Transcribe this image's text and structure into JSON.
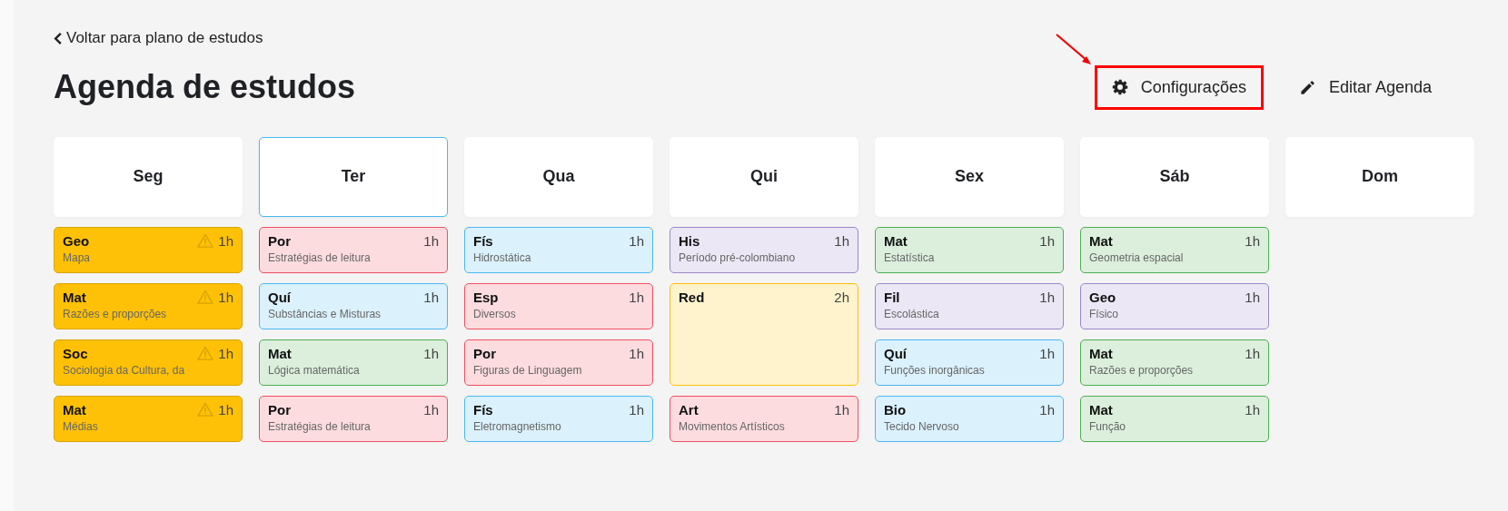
{
  "back_link": "Voltar para plano de estudos",
  "title": "Agenda de estudos",
  "actions": [
    {
      "kind": "settings",
      "label": "Configurações",
      "highlighted": true
    },
    {
      "kind": "edit",
      "label": "Editar Agenda",
      "highlighted": false
    }
  ],
  "days": [
    {
      "name": "Seg",
      "selected": false,
      "cards": [
        {
          "subject": "Geo",
          "topic": "Mapa",
          "hours": "1h",
          "warning": true,
          "kind": "single",
          "color": "#ffc107"
        },
        {
          "subject": "Mat",
          "topic": "Razões e proporções",
          "hours": "1h",
          "warning": true,
          "kind": "single",
          "color": "#ffc107"
        },
        {
          "subject": "Soc",
          "topic": "Sociologia da Cultura, da",
          "hours": "1h",
          "warning": true,
          "kind": "single",
          "color": "#ffc107"
        },
        {
          "subject": "Mat",
          "topic": "Médias",
          "hours": "1h",
          "warning": true,
          "kind": "single",
          "color": "#ffc107"
        }
      ]
    },
    {
      "name": "Ter",
      "selected": true,
      "cards": [
        {
          "subject": "Por",
          "topic": "Estratégias de leitura",
          "hours": "1h",
          "warning": false,
          "kind": "single",
          "color": "#f0505f"
        },
        {
          "subject": "Quí",
          "topic": "Substâncias e Misturas",
          "hours": "1h",
          "warning": false,
          "kind": "single",
          "color": "#4ab8f0"
        },
        {
          "subject": "Mat",
          "topic": "Lógica matemática",
          "hours": "1h",
          "warning": false,
          "kind": "single",
          "color": "#4caf50"
        },
        {
          "subject": "Por",
          "topic": "Estratégias de leitura",
          "hours": "1h",
          "warning": false,
          "kind": "single",
          "color": "#f0505f"
        }
      ]
    },
    {
      "name": "Qua",
      "selected": false,
      "cards": [
        {
          "subject": "Fís",
          "topic": "Hidrostática",
          "hours": "1h",
          "warning": false,
          "kind": "single",
          "color": "#4ab8f0"
        },
        {
          "subject": "Esp",
          "topic": "Diversos",
          "hours": "1h",
          "warning": false,
          "kind": "single",
          "color": "#f0505f"
        },
        {
          "subject": "Por",
          "topic": "Figuras de Linguagem",
          "hours": "1h",
          "warning": false,
          "kind": "single",
          "color": "#f0505f"
        },
        {
          "subject": "Fís",
          "topic": "Eletromagnetismo",
          "hours": "1h",
          "warning": false,
          "kind": "single",
          "color": "#4ab8f0"
        }
      ]
    },
    {
      "name": "Qui",
      "selected": false,
      "cards": [
        {
          "subject": "His",
          "topic": "Período pré-colombiano",
          "hours": "1h",
          "warning": false,
          "kind": "single",
          "color": "#9b87c9"
        },
        {
          "subject": "Red",
          "hours": "2h",
          "warning": false,
          "kind": "double",
          "color": "#ffc107"
        },
        {
          "subject": "Art",
          "topic": "Movimentos Artísticos",
          "hours": "1h",
          "warning": false,
          "kind": "single",
          "color": "#f0505f"
        }
      ]
    },
    {
      "name": "Sex",
      "selected": false,
      "cards": [
        {
          "subject": "Mat",
          "topic": "Estatística",
          "hours": "1h",
          "warning": false,
          "kind": "single",
          "color": "#4caf50"
        },
        {
          "subject": "Fil",
          "topic": "Escolástica",
          "hours": "1h",
          "warning": false,
          "kind": "single",
          "color": "#9b87c9"
        },
        {
          "subject": "Quí",
          "topic": "Funções inorgânicas",
          "hours": "1h",
          "warning": false,
          "kind": "single",
          "color": "#4ab8f0"
        },
        {
          "subject": "Bio",
          "topic": "Tecido Nervoso",
          "hours": "1h",
          "warning": false,
          "kind": "single",
          "color": "#4ab8f0"
        }
      ]
    },
    {
      "name": "Sáb",
      "selected": false,
      "cards": [
        {
          "subject": "Mat",
          "topic": "Geometria espacial",
          "hours": "1h",
          "warning": false,
          "kind": "single",
          "color": "#4caf50"
        },
        {
          "subject": "Geo",
          "topic": "Físico",
          "hours": "1h",
          "warning": false,
          "kind": "single",
          "color": "#9b87c9"
        },
        {
          "subject": "Mat",
          "topic": "Razões e proporções",
          "hours": "1h",
          "warning": false,
          "kind": "single",
          "color": "#4caf50"
        },
        {
          "subject": "Mat",
          "topic": "Função",
          "hours": "1h",
          "warning": false,
          "kind": "single",
          "color": "#4caf50"
        }
      ]
    },
    {
      "name": "Dom",
      "selected": false
    }
  ]
}
